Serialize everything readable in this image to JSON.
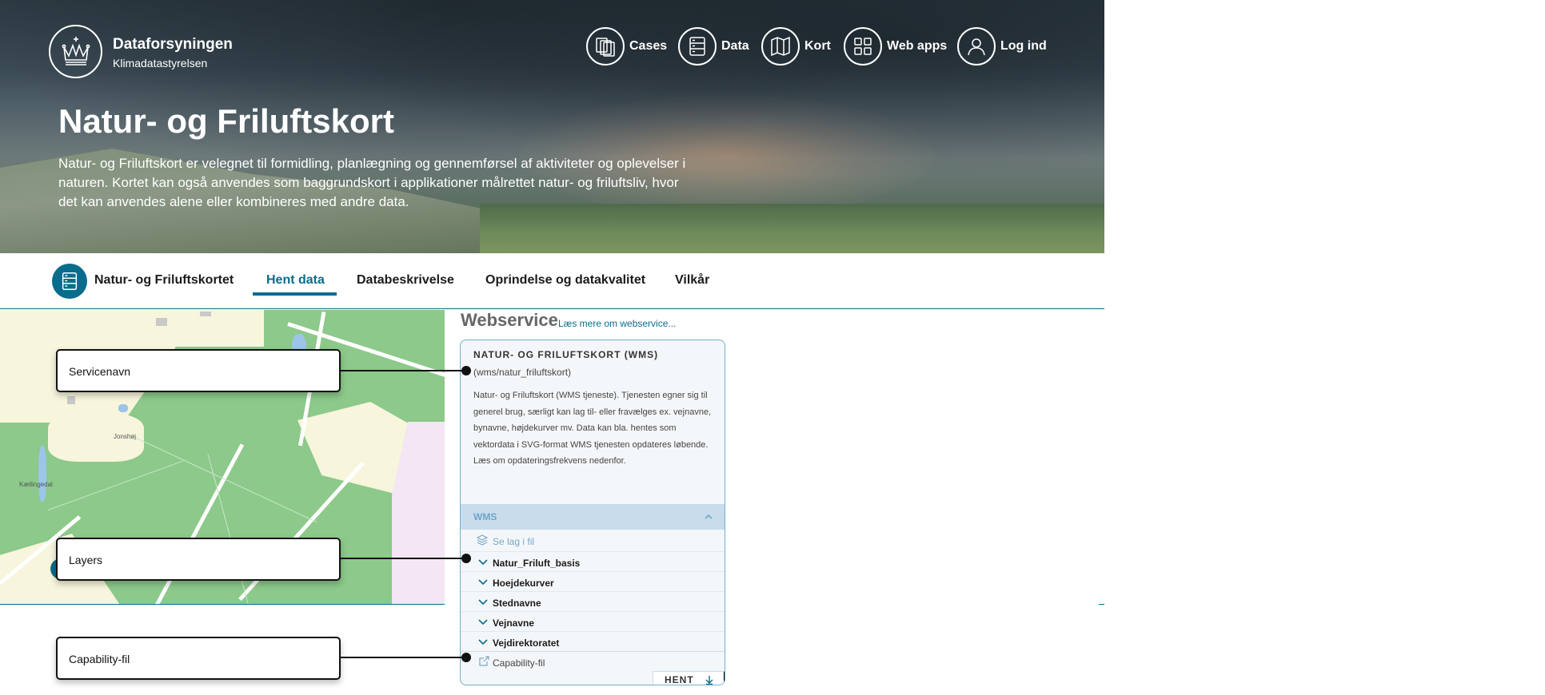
{
  "brand": {
    "name": "Dataforsyningen",
    "subtitle": "Klimadatastyrelsen",
    "logo_icon": "crown-icon"
  },
  "top_nav": {
    "items": [
      {
        "label": "Cases",
        "icon": "documents-icon"
      },
      {
        "label": "Data",
        "icon": "server-icon"
      },
      {
        "label": "Kort",
        "icon": "map-icon"
      },
      {
        "label": "Web apps",
        "icon": "grid-icon"
      },
      {
        "label": "Log ind",
        "icon": "user-icon"
      }
    ]
  },
  "hero": {
    "title": "Natur- og Friluftskort",
    "description": "Natur- og Friluftskort er velegnet til formidling, planlægning og gennemførsel af aktiviteter og oplevelser i naturen. Kortet kan også anvendes som baggrundskort i applikationer målrettet natur- og friluftsliv, hvor det kan anvendes alene eller kombineres med andre data."
  },
  "tabs": {
    "dataset_name": "Natur- og Friluftskortet",
    "dataset_icon": "server-icon",
    "items": [
      {
        "label": "Hent data",
        "active": true
      },
      {
        "label": "Databeskrivelse",
        "active": false
      },
      {
        "label": "Oprindelse og datakvalitet",
        "active": false
      },
      {
        "label": "Vilkår",
        "active": false
      }
    ]
  },
  "map": {
    "place_names": [
      "Jonshøj",
      "Kællingedal"
    ]
  },
  "webservice": {
    "heading": "Webservice",
    "more_link": "Læs mere om webservice...",
    "card": {
      "title": "NATUR- OG FRILUFTSKORT (WMS)",
      "path": "(wms/natur_friluftskort)",
      "description": "Natur- og Friluftskort (WMS tjeneste). Tjenesten egner sig til generel brug, særligt kan lag til- eller fravælges ex. vejnavne, bynavne, højdekurver mv. Data kan bla. hentes som vektordata i SVG-format WMS tjenesten opdateres løbende. Læs om opdateringsfrekvens nedenfor.",
      "accordion_label": "WMS",
      "file_link": "Se lag i fil",
      "layers": [
        "Natur_Friluft_basis",
        "Hoejdekurver",
        "Stednavne",
        "Vejnavne",
        "Vejdirektoratet"
      ],
      "capability_link": "Capability-fil",
      "download_label": "HENT"
    }
  },
  "callouts": [
    "Servicenavn",
    "Layers",
    "Capability-fil"
  ],
  "colors": {
    "accent": "#0a6c8c",
    "map_green": "#8cc98a",
    "map_field": "#f7f5dc",
    "panel_bg": "#f4f7fa",
    "accordion_bg": "#c9dcec"
  }
}
